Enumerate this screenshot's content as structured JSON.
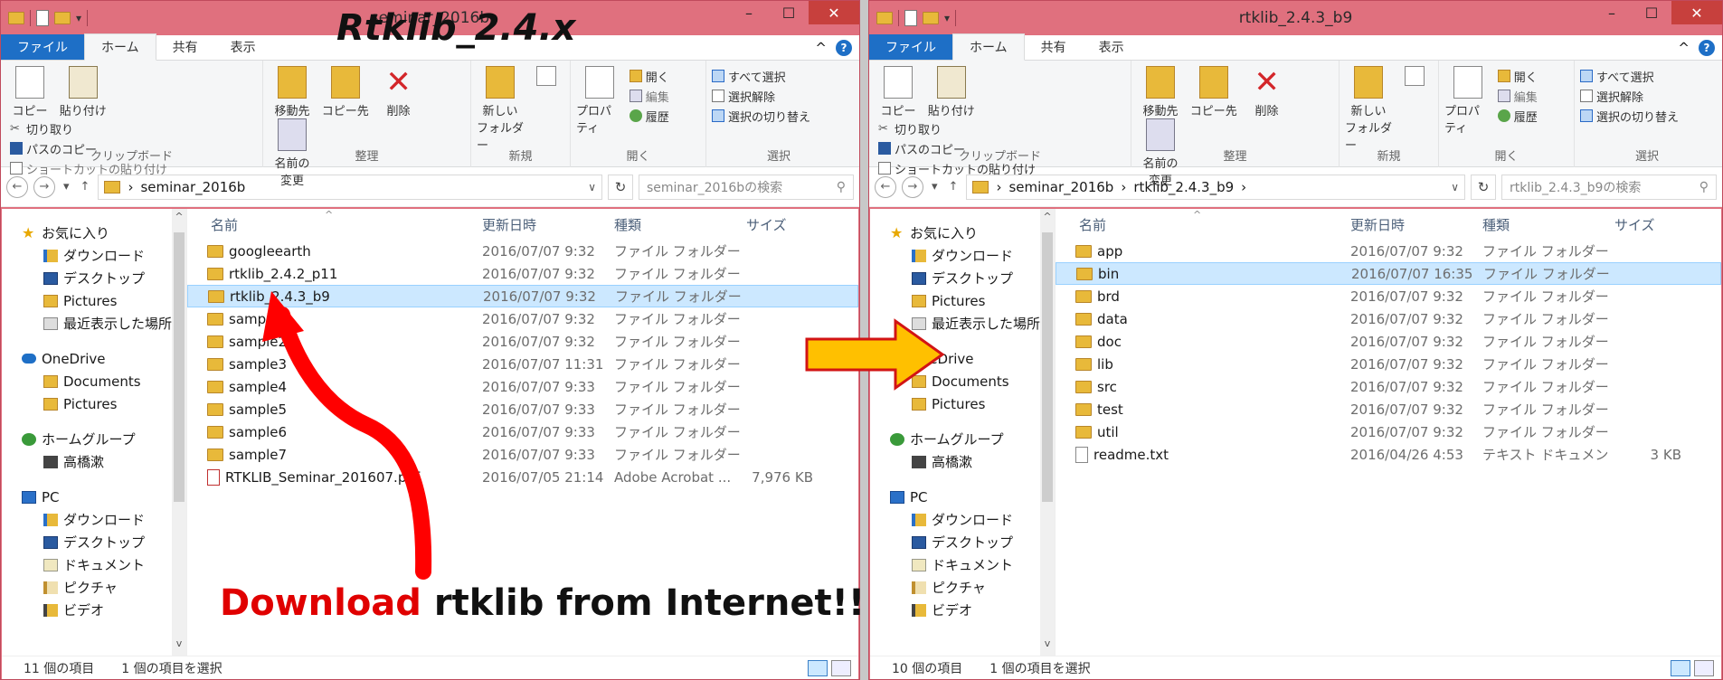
{
  "colors": {
    "accent": "#1e6fc6",
    "titlebar": "#e0707e",
    "selection": "#cce8ff",
    "arrow_red": "#ff0000",
    "arrow_yellow": "#ffc000"
  },
  "annotations": {
    "title": "Rtklib_2.4.x",
    "download_red": "Download",
    "download_rest": " rtklib from Internet!!"
  },
  "ribbon": {
    "tabs": [
      "ファイル",
      "ホーム",
      "共有",
      "表示"
    ],
    "clipboard": {
      "copy": "コピー",
      "paste": "貼り付け",
      "cut": "切り取り",
      "copy_path": "パスのコピー",
      "paste_shortcut": "ショートカットの貼り付け",
      "label": "クリップボード"
    },
    "organize": {
      "move": "移動先",
      "copy_to": "コピー先",
      "delete": "削除",
      "rename1": "名前の",
      "rename2": "変更",
      "label": "整理"
    },
    "new": {
      "folder1": "新しい",
      "folder2": "フォルダー",
      "label": "新規"
    },
    "open": {
      "props": "プロパティ",
      "open": "開く",
      "edit": "編集",
      "history": "履歴",
      "label": "開く"
    },
    "select": {
      "all": "すべて選択",
      "none": "選択解除",
      "invert": "選択の切り替え",
      "label": "選択"
    }
  },
  "columns": {
    "name": "名前",
    "date": "更新日時",
    "type": "種類",
    "size": "サイズ"
  },
  "left": {
    "title": "seminar_2016b",
    "breadcrumb": [
      "seminar_2016b"
    ],
    "search_placeholder": "seminar_2016bの検索",
    "rows": [
      {
        "name": "googleearth",
        "date": "2016/07/07 9:32",
        "type": "ファイル フォルダー",
        "size": "",
        "icon": "folder"
      },
      {
        "name": "rtklib_2.4.2_p11",
        "date": "2016/07/07 9:32",
        "type": "ファイル フォルダー",
        "size": "",
        "icon": "folder"
      },
      {
        "name": "rtklib_2.4.3_b9",
        "date": "2016/07/07 9:32",
        "type": "ファイル フォルダー",
        "size": "",
        "icon": "folder",
        "selected": true
      },
      {
        "name": "sample1",
        "date": "2016/07/07 9:32",
        "type": "ファイル フォルダー",
        "size": "",
        "icon": "folder"
      },
      {
        "name": "sample2",
        "date": "2016/07/07 9:32",
        "type": "ファイル フォルダー",
        "size": "",
        "icon": "folder"
      },
      {
        "name": "sample3",
        "date": "2016/07/07 11:31",
        "type": "ファイル フォルダー",
        "size": "",
        "icon": "folder"
      },
      {
        "name": "sample4",
        "date": "2016/07/07 9:33",
        "type": "ファイル フォルダー",
        "size": "",
        "icon": "folder"
      },
      {
        "name": "sample5",
        "date": "2016/07/07 9:33",
        "type": "ファイル フォルダー",
        "size": "",
        "icon": "folder"
      },
      {
        "name": "sample6",
        "date": "2016/07/07 9:33",
        "type": "ファイル フォルダー",
        "size": "",
        "icon": "folder"
      },
      {
        "name": "sample7",
        "date": "2016/07/07 9:33",
        "type": "ファイル フォルダー",
        "size": "",
        "icon": "folder"
      },
      {
        "name": "RTKLIB_Seminar_201607.pdf",
        "date": "2016/07/05 21:14",
        "type": "Adobe Acrobat ...",
        "size": "7,976 KB",
        "icon": "pdf"
      }
    ],
    "status_count": "11 個の項目",
    "status_sel": "1 個の項目を選択"
  },
  "right": {
    "title": "rtklib_2.4.3_b9",
    "breadcrumb": [
      "seminar_2016b",
      "rtklib_2.4.3_b9"
    ],
    "search_placeholder": "rtklib_2.4.3_b9の検索",
    "rows": [
      {
        "name": "app",
        "date": "2016/07/07 9:32",
        "type": "ファイル フォルダー",
        "size": "",
        "icon": "folder"
      },
      {
        "name": "bin",
        "date": "2016/07/07 16:35",
        "type": "ファイル フォルダー",
        "size": "",
        "icon": "folder",
        "selected": true
      },
      {
        "name": "brd",
        "date": "2016/07/07 9:32",
        "type": "ファイル フォルダー",
        "size": "",
        "icon": "folder"
      },
      {
        "name": "data",
        "date": "2016/07/07 9:32",
        "type": "ファイル フォルダー",
        "size": "",
        "icon": "folder"
      },
      {
        "name": "doc",
        "date": "2016/07/07 9:32",
        "type": "ファイル フォルダー",
        "size": "",
        "icon": "folder"
      },
      {
        "name": "lib",
        "date": "2016/07/07 9:32",
        "type": "ファイル フォルダー",
        "size": "",
        "icon": "folder"
      },
      {
        "name": "src",
        "date": "2016/07/07 9:32",
        "type": "ファイル フォルダー",
        "size": "",
        "icon": "folder"
      },
      {
        "name": "test",
        "date": "2016/07/07 9:32",
        "type": "ファイル フォルダー",
        "size": "",
        "icon": "folder"
      },
      {
        "name": "util",
        "date": "2016/07/07 9:32",
        "type": "ファイル フォルダー",
        "size": "",
        "icon": "folder"
      },
      {
        "name": "readme.txt",
        "date": "2016/04/26 4:53",
        "type": "テキスト ドキュメント",
        "size": "3 KB",
        "icon": "txt"
      }
    ],
    "status_count": "10 個の項目",
    "status_sel": "1 個の項目を選択"
  },
  "nav": [
    {
      "label": "お気に入り",
      "icon": "star-icon",
      "level": 1
    },
    {
      "label": "ダウンロード",
      "icon": "download-folder-icon",
      "level": 2
    },
    {
      "label": "デスクトップ",
      "icon": "desktop-icon",
      "level": 2
    },
    {
      "label": "Pictures",
      "icon": "folder-icon",
      "level": 2
    },
    {
      "label": "最近表示した場所",
      "icon": "recent-places-icon",
      "level": 2
    },
    {
      "label": "OneDrive",
      "icon": "cloud-icon",
      "level": 1,
      "gap": true
    },
    {
      "label": "Documents",
      "icon": "folder-icon",
      "level": 2
    },
    {
      "label": "Pictures",
      "icon": "folder-icon",
      "level": 2
    },
    {
      "label": "ホームグループ",
      "icon": "homegroup-icon",
      "level": 1,
      "gap": true
    },
    {
      "label": "高橋漱",
      "icon": "user-icon",
      "level": 2
    },
    {
      "label": "PC",
      "icon": "pc-icon",
      "level": 1,
      "gap": true
    },
    {
      "label": "ダウンロード",
      "icon": "download-folder-icon",
      "level": 2
    },
    {
      "label": "デスクトップ",
      "icon": "desktop-icon",
      "level": 2
    },
    {
      "label": "ドキュメント",
      "icon": "documents-icon",
      "level": 2
    },
    {
      "label": "ピクチャ",
      "icon": "pictures-icon",
      "level": 2
    },
    {
      "label": "ビデオ",
      "icon": "videos-icon",
      "level": 2
    }
  ]
}
